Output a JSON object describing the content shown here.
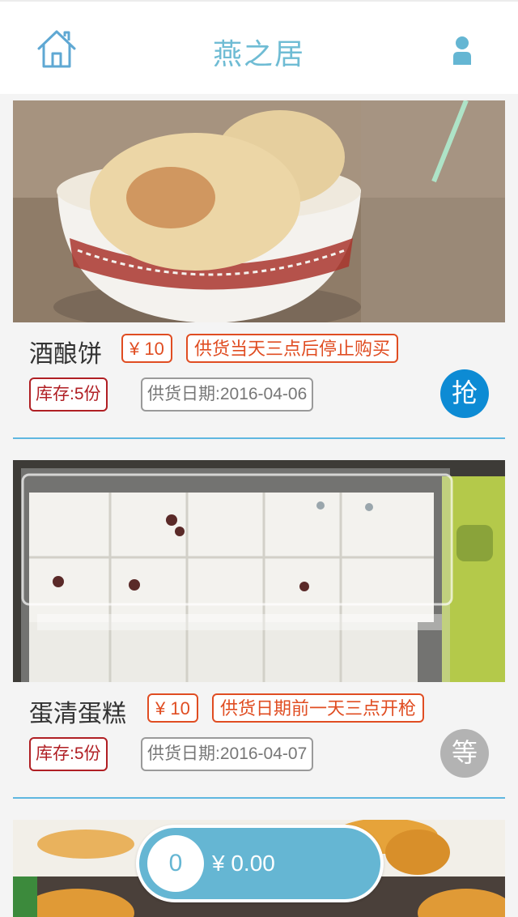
{
  "header": {
    "title": "燕之居",
    "home_icon": "home-icon",
    "user_icon": "user-icon"
  },
  "products": [
    {
      "name": "酒酿饼",
      "price": "¥ 10",
      "notice": "供货当天三点后停止购买",
      "stock": "库存:5份",
      "supply_date": "供货日期:2016-04-06",
      "action": "抢",
      "action_color": "#0d8bd4"
    },
    {
      "name": "蛋清蛋糕",
      "price": "¥ 10",
      "notice": "供货日期前一天三点开枪",
      "stock": "库存:5份",
      "supply_date": "供货日期:2016-04-07",
      "action": "等",
      "action_color": "#b3b3b3"
    }
  ],
  "cart": {
    "count": "0",
    "total": "¥ 0.00"
  },
  "colors": {
    "accent": "#6fbcd4",
    "price_tag": "#e04d22",
    "stock_tag": "#b01f24",
    "divider": "#5fb7e0"
  }
}
